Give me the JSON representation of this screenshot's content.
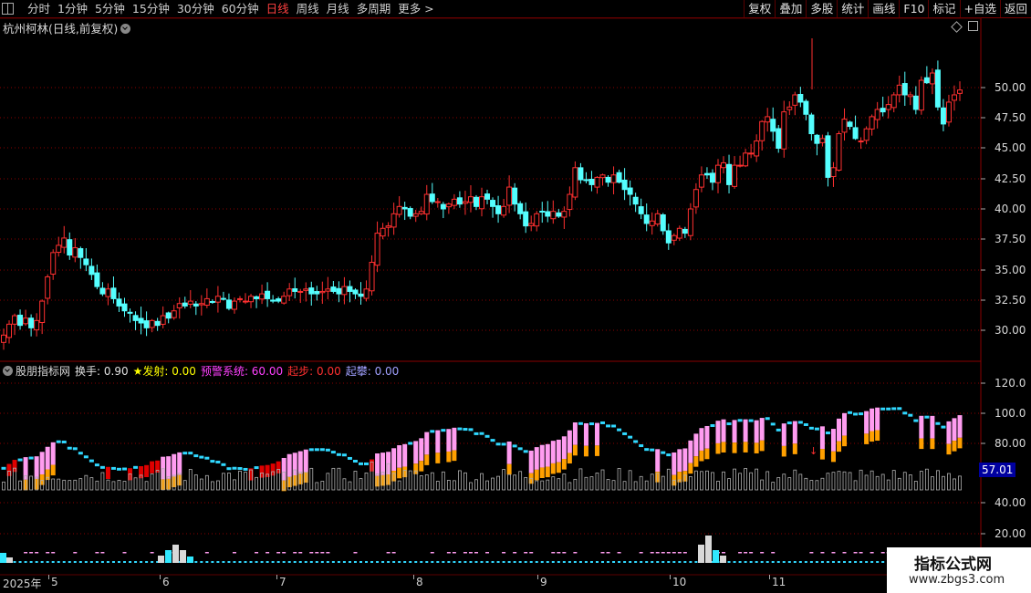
{
  "toolbar": {
    "periods": [
      "分时",
      "1分钟",
      "5分钟",
      "15分钟",
      "30分钟",
      "60分钟",
      "日线",
      "周线",
      "月线",
      "多周期",
      "更多 >"
    ],
    "active_period": "日线",
    "right_buttons": [
      "复权",
      "叠加",
      "多股",
      "统计",
      "画线",
      "F10",
      "标记",
      "+自选",
      "返回"
    ]
  },
  "stock": {
    "title": "杭州柯林(日线,前复权)"
  },
  "price_axis": [
    "50.00",
    "47.50",
    "45.00",
    "42.50",
    "40.00",
    "37.50",
    "35.00",
    "32.50",
    "30.00"
  ],
  "indicator": {
    "name": "股朋指标网",
    "items": [
      {
        "label": "换手: 0.90",
        "color": "#e0e0e0"
      },
      {
        "label": "★发射: 0.00",
        "color": "#ffff00"
      },
      {
        "label": "预警系统: 60.00",
        "color": "#ff40ff"
      },
      {
        "label": "起步: 0.00",
        "color": "#ff3030"
      },
      {
        "label": "起攀: 0.00",
        "color": "#a0a0ff"
      }
    ],
    "axis": [
      "120.0",
      "100.0",
      "80.00",
      "40.00",
      "20.00"
    ],
    "current_value": "57.01"
  },
  "dates": [
    {
      "label": "2025年"
    },
    {
      "label": "5"
    },
    {
      "label": "6"
    },
    {
      "label": "7"
    },
    {
      "label": "8"
    },
    {
      "label": "9"
    },
    {
      "label": "10"
    },
    {
      "label": "11"
    }
  ],
  "watermark": {
    "line1": "指标公式网",
    "line2": "www.zbgs3.com"
  },
  "colors": {
    "up": "#ff3030",
    "down": "#54ffff",
    "grid": "#8a0000",
    "pink": "#ff9cf0",
    "orange": "#ffa000",
    "cyan": "#30d8ff"
  },
  "chart_data": {
    "type": "candlestick",
    "ylim": [
      28.5,
      55
    ],
    "closes": [
      29.6,
      30.5,
      31.2,
      30.4,
      31.0,
      30.2,
      30.8,
      32.4,
      34.4,
      36.4,
      37.0,
      37.6,
      36.2,
      36.8,
      36.0,
      35.4,
      34.6,
      33.6,
      33.0,
      33.4,
      32.6,
      32.0,
      31.6,
      31.4,
      30.8,
      30.6,
      30.2,
      30.8,
      30.4,
      31.2,
      31.0,
      31.6,
      32.2,
      32.0,
      32.4,
      32.0,
      32.2,
      32.6,
      32.3,
      32.8,
      32.6,
      31.8,
      32.4,
      32.6,
      32.4,
      32.8,
      32.6,
      33.0,
      32.6,
      32.4,
      32.4,
      32.8,
      33.4,
      33.2,
      33.2,
      33.4,
      33.0,
      33.0,
      33.2,
      33.4,
      33.2,
      33.0,
      33.6,
      33.2,
      33.0,
      32.8,
      33.4,
      35.6,
      38.0,
      38.4,
      38.6,
      39.6,
      40.2,
      40.0,
      39.4,
      39.6,
      39.8,
      41.2,
      40.6,
      40.6,
      40.0,
      40.4,
      40.8,
      40.4,
      40.6,
      41.0,
      40.2,
      41.0,
      40.8,
      40.2,
      39.6,
      40.2,
      41.8,
      40.4,
      39.6,
      38.6,
      38.8,
      39.6,
      39.8,
      39.4,
      39.8,
      39.4,
      39.8,
      41.2,
      43.4,
      42.4,
      42.4,
      42.0,
      42.6,
      42.8,
      42.2,
      42.8,
      42.2,
      41.6,
      41.2,
      40.4,
      39.6,
      38.8,
      39.0,
      39.6,
      38.2,
      37.2,
      37.8,
      38.4,
      38.0,
      40.0,
      41.6,
      42.8,
      42.8,
      42.2,
      43.6,
      43.8,
      42.0,
      43.6,
      43.6,
      44.6,
      44.6,
      45.6,
      47.2,
      47.6,
      46.4,
      45.0,
      48.0,
      48.4,
      49.4,
      48.8,
      47.8,
      46.2,
      45.4,
      45.8,
      42.6,
      43.4,
      46.2,
      47.4,
      46.8,
      45.8,
      45.6,
      46.6,
      47.6,
      48.2,
      48.0,
      48.6,
      49.4,
      50.2,
      49.4,
      49.4,
      48.2,
      50.6,
      50.4,
      51.2,
      48.4,
      47.0,
      48.8,
      49.4,
      49.8
    ]
  }
}
